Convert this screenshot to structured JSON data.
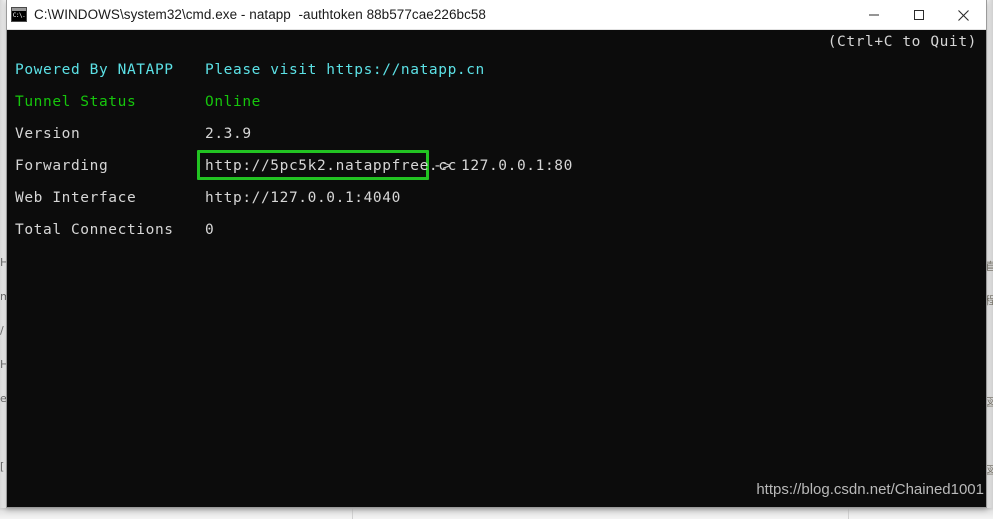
{
  "window": {
    "title": "C:\\WINDOWS\\system32\\cmd.exe - natapp  -authtoken 88b577cae226bc58",
    "icon": "cmd-icon",
    "controls": {
      "minimize_label": "Minimize",
      "maximize_label": "Maximize",
      "close_label": "Close"
    }
  },
  "console": {
    "hint": "(Ctrl+C to Quit)",
    "rows": [
      {
        "label": "Powered By NATAPP",
        "value": "Please visit https://natapp.cn",
        "color": "#5ce1e6"
      },
      {
        "label": "Tunnel Status",
        "value": "Online",
        "color": "#16c60c"
      },
      {
        "label": "Version",
        "value": "2.3.9",
        "color": "#d6d6d6"
      },
      {
        "label": "Forwarding",
        "value": "http://5pc5k2.natappfree.cc -> 127.0.0.1:80",
        "color": "#d6d6d6"
      },
      {
        "label": "Web Interface",
        "value": "http://127.0.0.1:4040",
        "color": "#d6d6d6"
      },
      {
        "label": "Total Connections",
        "value": "0",
        "color": "#d6d6d6"
      }
    ],
    "forwarding": {
      "url": "http://5pc5k2.natappfree.cc",
      "arrow_target": "-> 127.0.0.1:80",
      "highlight_color": "#22c322"
    }
  },
  "watermark": "https://blog.csdn.net/Chained1001",
  "background": {
    "left_glyphs": "H\nm\n/\nH\ne\n\n[",
    "right_glyphs": "直\n程\n\n\n図\n\n図"
  }
}
